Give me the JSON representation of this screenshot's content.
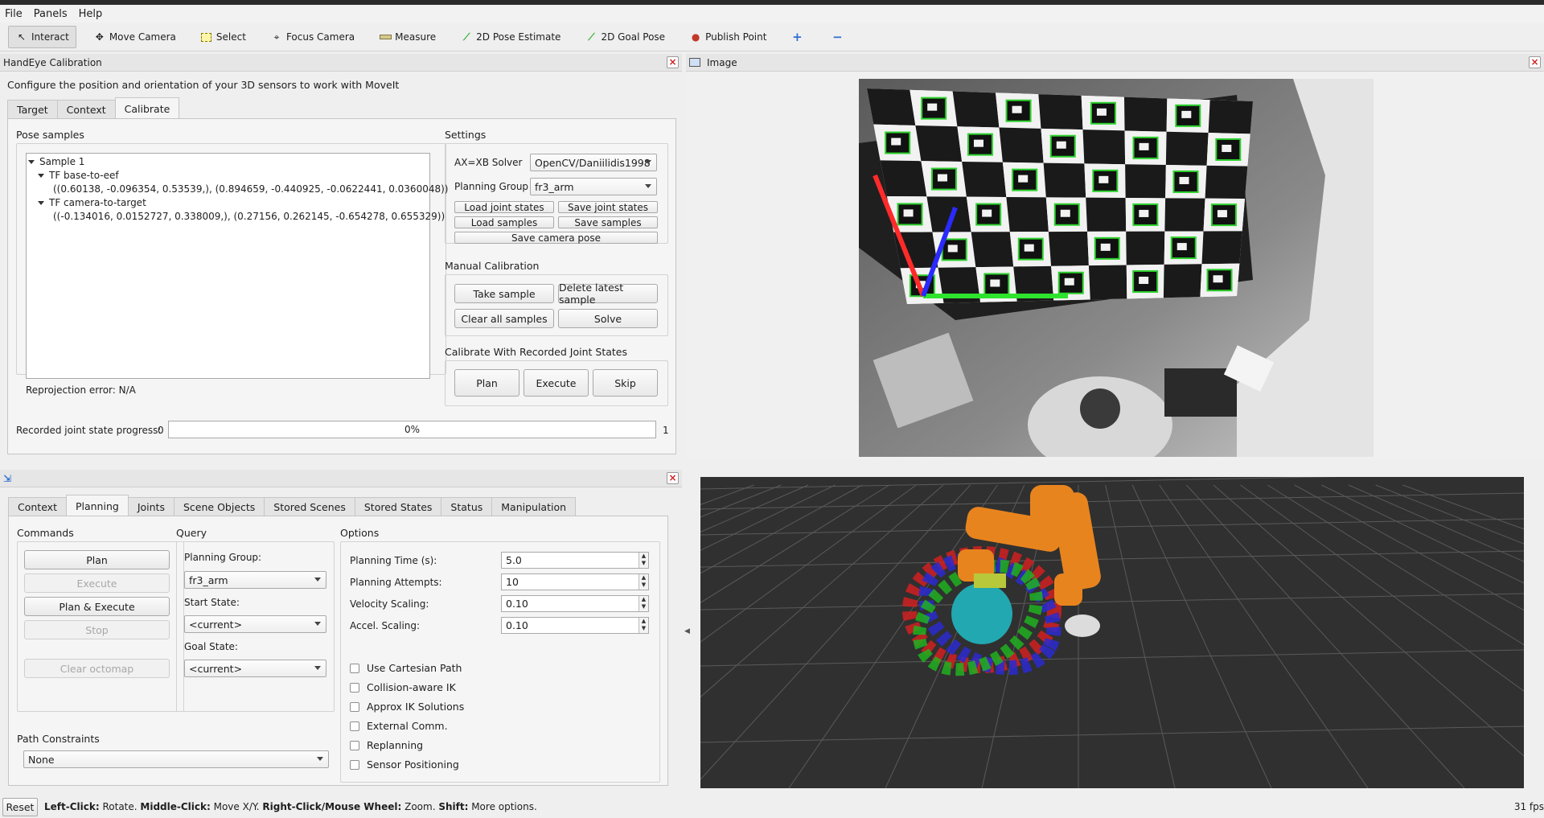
{
  "menu": [
    "File",
    "Panels",
    "Help"
  ],
  "toolbar": [
    {
      "label": "Interact",
      "icon": "cursor-icon",
      "active": true
    },
    {
      "label": "Move Camera",
      "icon": "move-camera-icon"
    },
    {
      "label": "Select",
      "icon": "select-icon"
    },
    {
      "label": "Focus Camera",
      "icon": "focus-camera-icon"
    },
    {
      "label": "Measure",
      "icon": "measure-icon"
    },
    {
      "label": "2D Pose Estimate",
      "icon": "pose-estimate-icon"
    },
    {
      "label": "2D Goal Pose",
      "icon": "goal-pose-icon"
    },
    {
      "label": "Publish Point",
      "icon": "publish-point-icon"
    }
  ],
  "handeye": {
    "title": "HandEye Calibration",
    "description": "Configure the position and orientation of your 3D sensors to work with MoveIt",
    "tabs": [
      "Target",
      "Context",
      "Calibrate"
    ],
    "pose_samples_label": "Pose samples",
    "tree": {
      "sample": "Sample 1",
      "tf1_label": "TF base-to-eef",
      "tf1_value": "((0.60138, -0.096354, 0.53539,), (0.894659, -0.440925, -0.0622441, 0.0360048))",
      "tf2_label": "TF camera-to-target",
      "tf2_value": "((-0.134016, 0.0152727, 0.338009,), (0.27156, 0.262145, -0.654278, 0.655329))"
    },
    "reprojection": "Reprojection error: N/A",
    "settings": {
      "label": "Settings",
      "solver_label": "AX=XB Solver",
      "solver_value": "OpenCV/Daniilidis1998",
      "group_label": "Planning Group",
      "group_value": "fr3_arm",
      "load_joint": "Load joint states",
      "save_joint": "Save joint states",
      "load_samples": "Load samples",
      "save_samples": "Save samples",
      "save_camera": "Save camera pose"
    },
    "manual": {
      "label": "Manual Calibration",
      "take": "Take sample",
      "delete": "Delete latest sample",
      "clear": "Clear all samples",
      "solve": "Solve"
    },
    "recorded": {
      "label": "Calibrate With Recorded Joint States",
      "plan": "Plan",
      "execute": "Execute",
      "skip": "Skip"
    },
    "progress": {
      "label": "Recorded joint state progress:",
      "min": "0",
      "max": "1",
      "text": "0%",
      "fraction": 0
    }
  },
  "image_panel": {
    "title": "Image"
  },
  "motion": {
    "tabs": [
      "Context",
      "Planning",
      "Joints",
      "Scene Objects",
      "Stored Scenes",
      "Stored States",
      "Status",
      "Manipulation"
    ],
    "commands": {
      "label": "Commands",
      "plan": "Plan",
      "execute": "Execute",
      "plan_execute": "Plan & Execute",
      "stop": "Stop",
      "clear_octomap": "Clear octomap"
    },
    "query": {
      "label": "Query",
      "group_label": "Planning Group:",
      "group_value": "fr3_arm",
      "start_label": "Start State:",
      "start_value": "<current>",
      "goal_label": "Goal State:",
      "goal_value": "<current>"
    },
    "options": {
      "label": "Options",
      "time_label": "Planning Time (s):",
      "time_value": "5.0",
      "attempts_label": "Planning Attempts:",
      "attempts_value": "10",
      "velocity_label": "Velocity Scaling:",
      "velocity_value": "0.10",
      "accel_label": "Accel. Scaling:",
      "accel_value": "0.10",
      "checks": [
        "Use Cartesian Path",
        "Collision-aware IK",
        "Approx IK Solutions",
        "External Comm.",
        "Replanning",
        "Sensor Positioning"
      ]
    },
    "path": {
      "label": "Path Constraints",
      "value": "None"
    }
  },
  "status": {
    "reset": "Reset",
    "hint_parts": [
      {
        "b": "Left-Click:",
        "t": " Rotate. "
      },
      {
        "b": "Middle-Click:",
        "t": " Move X/Y. "
      },
      {
        "b": "Right-Click/Mouse Wheel:",
        "t": " Zoom. "
      },
      {
        "b": "Shift:",
        "t": " More options."
      }
    ],
    "fps": "31 fps"
  },
  "colors": {
    "axis_x": "#ff2a2a",
    "axis_y": "#2ee32e",
    "axis_z": "#2a2aff",
    "robot": "#e8841e",
    "marker": "#2dd12d"
  }
}
